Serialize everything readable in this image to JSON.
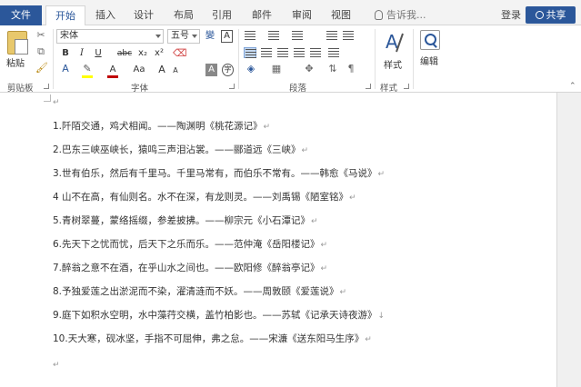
{
  "tabs": {
    "file": "文件",
    "items": [
      "开始",
      "插入",
      "设计",
      "布局",
      "引用",
      "邮件",
      "审阅",
      "视图"
    ],
    "active_index": 0,
    "tell_me": "告诉我...",
    "login": "登录",
    "share": "共享"
  },
  "ribbon": {
    "clipboard": {
      "paste": "粘贴",
      "label": "剪贴板"
    },
    "font": {
      "font_name": "宋体",
      "font_size": "五号",
      "wen": "變",
      "a_box": "A",
      "bold": "B",
      "italic": "I",
      "underline": "U",
      "strike": "abc",
      "subscript": "x₂",
      "superscript": "x²",
      "font_color": "A",
      "change_case": "Aa",
      "grow": "A",
      "shrink": "A",
      "char_shade": "A",
      "enclose": "字",
      "label": "字体"
    },
    "paragraph": {
      "label": "段落"
    },
    "styles": {
      "button": "样式",
      "label": "样式"
    },
    "editing": {
      "button": "编辑"
    }
  },
  "document": {
    "lines": [
      "1.阡陌交通，鸡犬相闻。——陶渊明《桃花源记》",
      "2.巴东三峡巫峡长，猿鸣三声泪沾裳。——郦道远《三峡》",
      "3.世有伯乐，然后有千里马。千里马常有，而伯乐不常有。——韩愈《马说》",
      "4 山不在高，有仙则名。水不在深，有龙则灵。——刘禹锡《陋室铭》",
      "5.青树翠蔓，蒙络摇缀，参差披拂。——柳宗元《小石潭记》",
      "6.先天下之忧而忧，后天下之乐而乐。——范仲淹《岳阳楼记》",
      "7.醉翁之意不在酒，在乎山水之间也。——欧阳修《醉翁亭记》",
      "8.予独爱莲之出淤泥而不染，濯清涟而不妖。——周敦颐《爱莲说》",
      "9.庭下如积水空明，水中藻荇交横，盖竹柏影也。——苏轼《记承天诗夜游》",
      "10.天大寒，砚冰坚，手指不可屈伸，弗之怠。——宋濂《送东阳马生序》"
    ],
    "line_marks": [
      "↵",
      "↵",
      "↵",
      "↵",
      "↵",
      "↵",
      "↵",
      "↵",
      "↓",
      "↵"
    ],
    "empty_mark": "↵"
  },
  "colors": {
    "accent": "#2b579a",
    "font_color_bar": "#c00000",
    "highlight_bar": "#ffff00"
  }
}
